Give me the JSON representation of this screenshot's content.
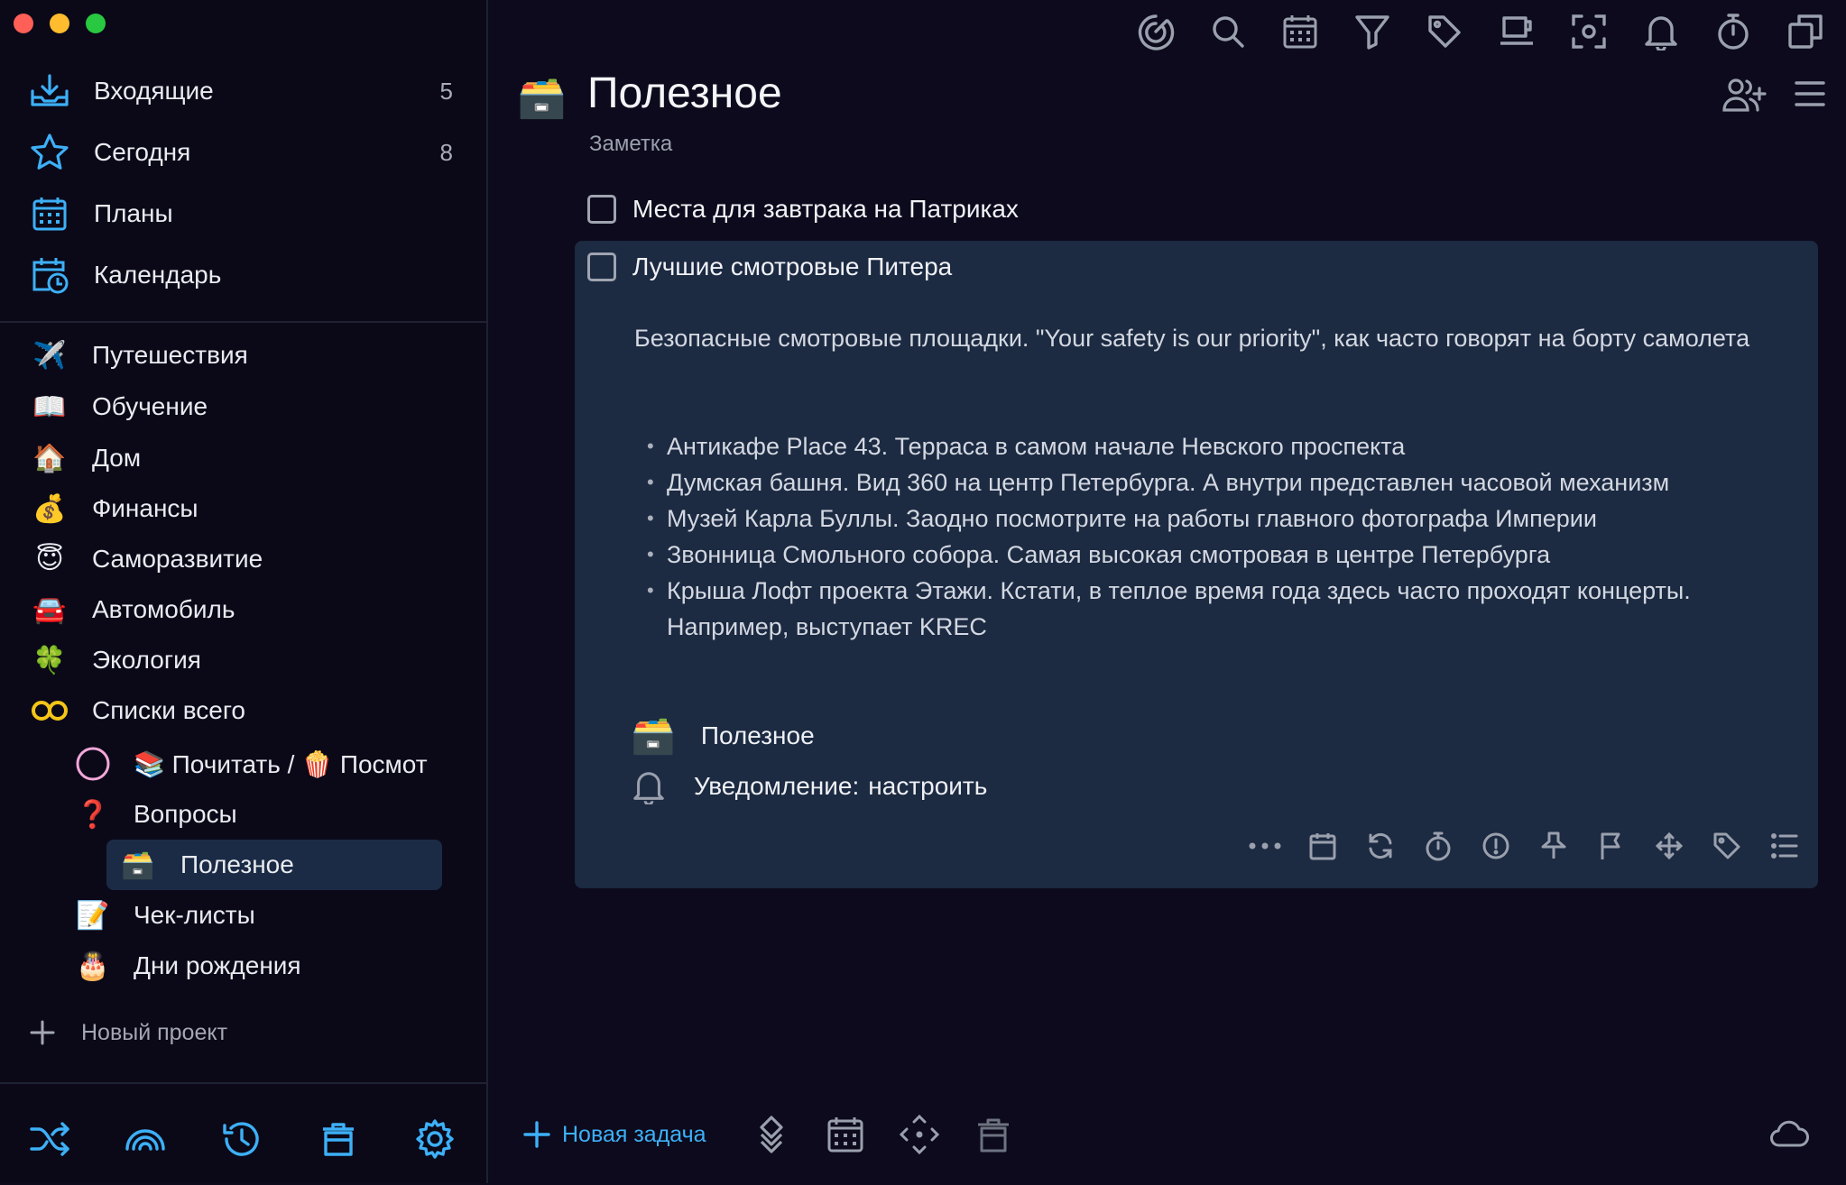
{
  "sidebar": {
    "smart_lists": [
      {
        "label": "Входящие",
        "count": "5"
      },
      {
        "label": "Сегодня",
        "count": "8"
      },
      {
        "label": "Планы",
        "count": ""
      },
      {
        "label": "Календарь",
        "count": ""
      }
    ],
    "projects": [
      {
        "emoji": "✈️",
        "label": "Путешествия"
      },
      {
        "emoji": "📖",
        "label": "Обучение"
      },
      {
        "emoji": "🏠",
        "label": "Дом"
      },
      {
        "emoji": "💰",
        "label": "Финансы"
      },
      {
        "emoji": "😇",
        "label": "Саморазвитие"
      },
      {
        "emoji": "🚘",
        "label": "Автомобиль"
      },
      {
        "emoji": "🍀",
        "label": "Экология"
      },
      {
        "emoji": "∞",
        "label": "Списки всего"
      }
    ],
    "subprojects": [
      {
        "emoji": "",
        "label": "📚 Почитать / 🍿 Посмот"
      },
      {
        "emoji": "❓",
        "label": "Вопросы"
      },
      {
        "emoji": "🗃️",
        "label": "Полезное"
      },
      {
        "emoji": "📝",
        "label": "Чек-листы"
      },
      {
        "emoji": "🎂",
        "label": "Дни рождения"
      }
    ],
    "new_project_label": "Новый проект"
  },
  "main": {
    "title": "Полезное",
    "subtitle": "Заметка",
    "tasks": [
      {
        "title": "Места для завтрака на Патриках"
      },
      {
        "title": "Лучшие смотровые Питера"
      }
    ],
    "expanded": {
      "description": "Безопасные смотровые площадки. \"Your safety is our priority\", как часто говорят на борту самолета",
      "bullets": [
        "Антикафе Place 43. Терраса в самом начале Невского проспекта",
        "Думская башня. Вид 360 на центр Петербурга. А внутри представлен часовой механизм",
        "Музей Карла Буллы. Заодно посмотрите на работы главного фотографа Империи",
        "Звонница Смольного собора. Самая высокая смотровая в центре Петербурга",
        "Крыша Лофт проекта Этажи. Кстати, в теплое время года здесь часто проходят концерты. Например, выступает KREC"
      ],
      "project_label": "Полезное",
      "reminder_label": "Уведомление:",
      "reminder_link": "настроить"
    },
    "new_task_label": "Новая задача"
  },
  "colors": {
    "accent": "#3db0f7",
    "background": "#0c0a1c",
    "card": "#1c2a42",
    "selected": "#1b2b45"
  }
}
